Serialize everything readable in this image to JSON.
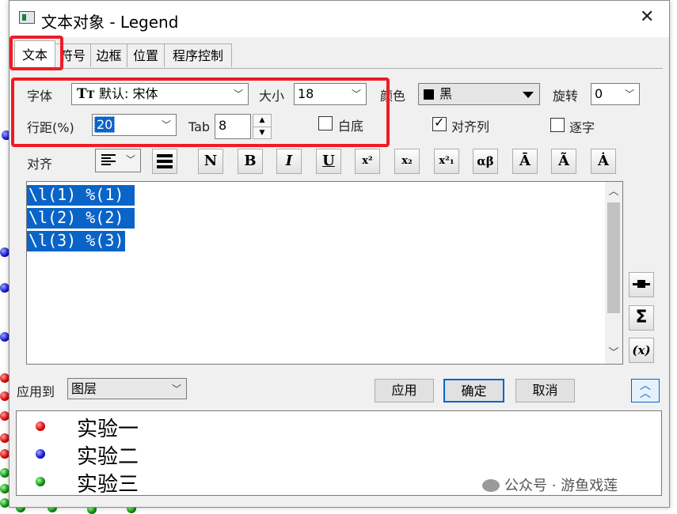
{
  "window": {
    "title": "文本对象 - Legend",
    "close_glyph": "✕"
  },
  "tabs": [
    {
      "label": "文本",
      "active": true
    },
    {
      "label": "符号"
    },
    {
      "label": "边框"
    },
    {
      "label": "位置"
    },
    {
      "label": "程序控制"
    }
  ],
  "font": {
    "label": "字体",
    "value": "默认: 宋体"
  },
  "size": {
    "label": "大小",
    "value": "18"
  },
  "color": {
    "label": "颜色",
    "value": "黑",
    "swatch": "#000000"
  },
  "rotate": {
    "label": "旋转",
    "value": "0"
  },
  "line_spacing": {
    "label": "行距(%)",
    "value": "20"
  },
  "tab": {
    "label": "Tab",
    "value": "8"
  },
  "white_bg": {
    "label": "白底",
    "checked": false
  },
  "align_columns": {
    "label": "对齐列",
    "checked": true
  },
  "per_char": {
    "label": "逐字",
    "checked": false
  },
  "align": {
    "label": "对齐"
  },
  "format_buttons": [
    "N",
    "B",
    "I",
    "U",
    "x²",
    "x₂",
    "x²₁",
    "αβ",
    "Ā",
    "Ã",
    "Ȧ"
  ],
  "editor": {
    "lines": [
      "\\l(1) %(1)",
      "\\l(2) %(2)",
      "\\l(3) %(3)"
    ]
  },
  "apply_to": {
    "label": "应用到",
    "value": "图层"
  },
  "buttons": {
    "apply": "应用",
    "ok": "确定",
    "cancel": "取消"
  },
  "preview": {
    "items": [
      {
        "label": "实验一",
        "color": "#e00000"
      },
      {
        "label": "实验二",
        "color": "#1010d0"
      },
      {
        "label": "实验三",
        "color": "#0a8a0a"
      }
    ]
  },
  "watermark": "公众号 · 游鱼戏莲",
  "highlight_color": "#ee1c25"
}
